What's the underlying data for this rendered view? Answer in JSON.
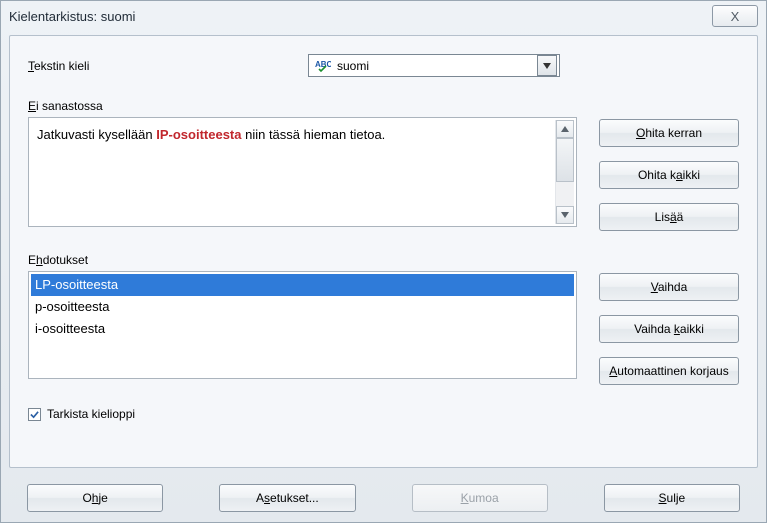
{
  "window": {
    "title": "Kielentarkistus: suomi",
    "close_glyph": "X"
  },
  "labels": {
    "language": "Tekstin kieli",
    "not_in_dict": "Ei sanastossa",
    "suggestions": "Ehdotukset",
    "check_grammar": "Tarkista kielioppi"
  },
  "language_combo": {
    "value": "suomi"
  },
  "sentence": {
    "before": "Jatkuvasti kysellään ",
    "error": "IP-osoitteesta",
    "after": " niin tässä hieman tietoa."
  },
  "suggestions": [
    "LP-osoitteesta",
    "p-osoitteesta",
    "i-osoitteesta"
  ],
  "buttons": {
    "ignore_once": "Ohita kerran",
    "ignore_all": "Ohita kaikki",
    "add": "Lisää",
    "change": "Vaihda",
    "change_all": "Vaihda kaikki",
    "autocorrect": "Automaattinen korjaus",
    "help": "Ohje",
    "settings": "Asetukset...",
    "undo": "Kumoa",
    "close": "Sulje"
  }
}
